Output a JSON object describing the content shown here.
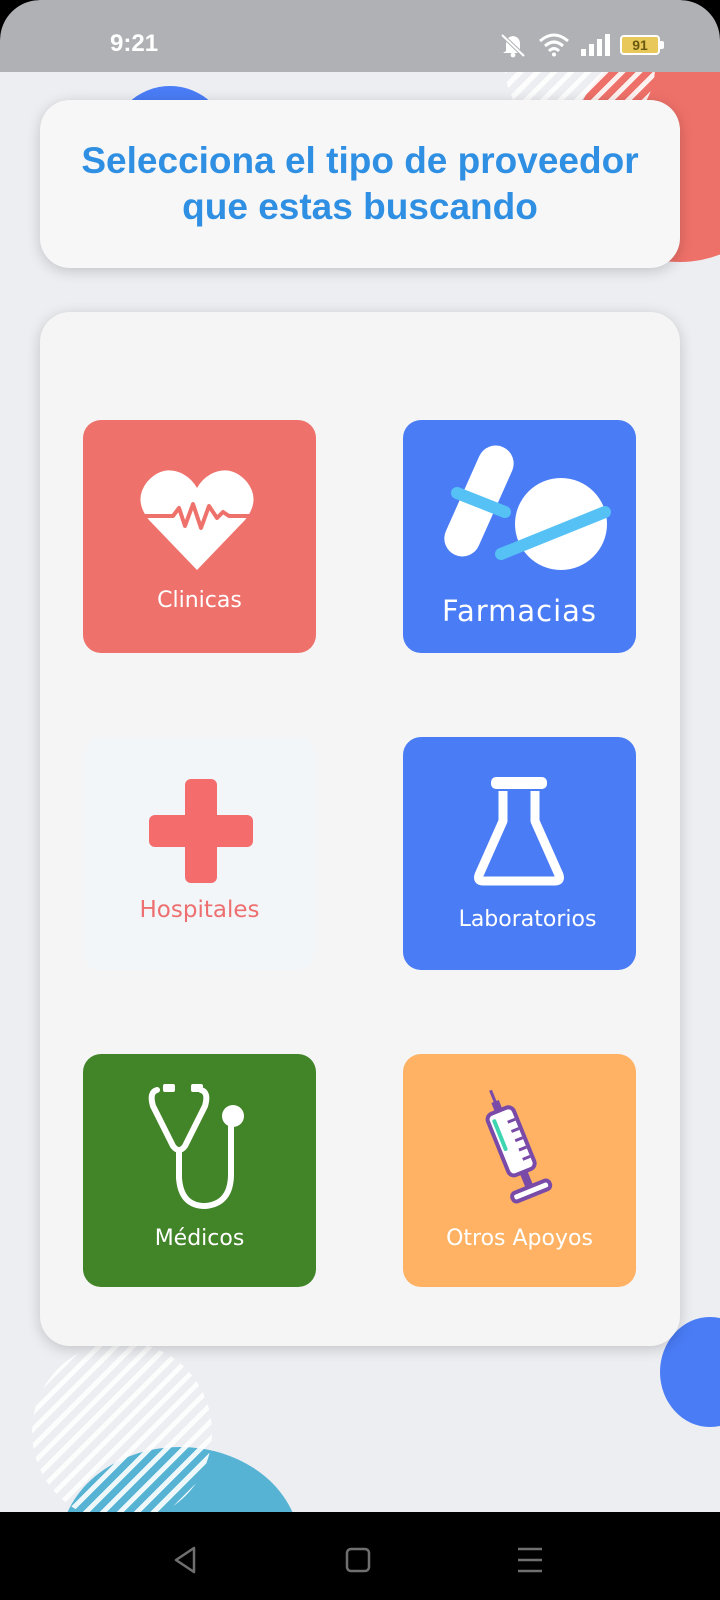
{
  "status_bar": {
    "time": "9:21",
    "battery": "91",
    "icons": [
      "mute-icon",
      "wifi-icon",
      "signal-icon",
      "battery-icon"
    ]
  },
  "header": {
    "title": "Selecciona el tipo de proveedor que estas buscando",
    "color": "#2f8fe2"
  },
  "categories": [
    {
      "label": "Clinicas",
      "icon": "heart-pulse-icon",
      "color": "#ee726b"
    },
    {
      "label": "Farmacias",
      "icon": "pills-icon",
      "color": "#4a7cf6"
    },
    {
      "label": "Hospitales",
      "icon": "medical-cross-icon",
      "color": "#f2f6f8"
    },
    {
      "label": "Laboratorios",
      "icon": "flask-icon",
      "color": "#4a7cf6"
    },
    {
      "label": "Médicos",
      "icon": "stethoscope-icon",
      "color": "#428428"
    },
    {
      "label": "Otros Apoyos",
      "icon": "syringe-icon",
      "color": "#ffb264"
    }
  ],
  "nav": {
    "buttons": [
      "back-icon",
      "home-icon",
      "menu-icon"
    ]
  }
}
